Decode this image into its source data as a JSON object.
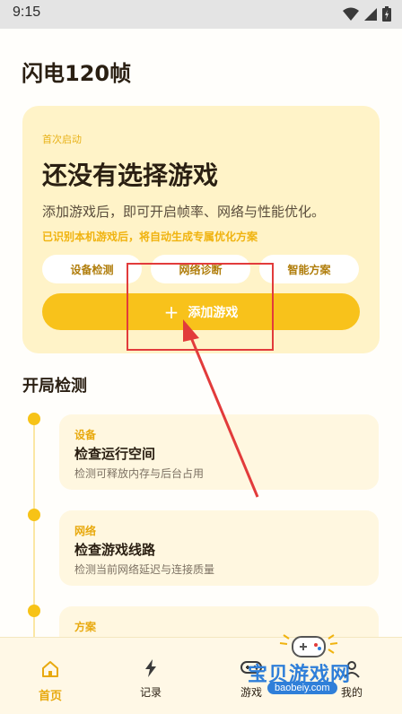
{
  "status_bar": {
    "time": "9:15",
    "icons": [
      "wifi-icon",
      "signal-icon",
      "battery-icon"
    ]
  },
  "page_title": "闪电120帧",
  "card": {
    "eyebrow": "首次启动",
    "heading": "还没有选择游戏",
    "description": "添加游戏后，即可开启帧率、网络与性能优化。",
    "hint": "已识别本机游戏后，将自动生成专属优化方案",
    "chips": [
      "设备检测",
      "网络诊断",
      "智能方案"
    ],
    "add_button": {
      "icon": "+",
      "label": "添加游戏"
    }
  },
  "section": {
    "title": "开局检测",
    "steps": [
      {
        "tag": "设备",
        "name": "检查运行空间",
        "sub": "检测可释放内存与后台占用"
      },
      {
        "tag": "网络",
        "name": "检查游戏线路",
        "sub": "检测当前网络延迟与连接质量"
      },
      {
        "tag": "方案",
        "name": "",
        "sub": ""
      }
    ]
  },
  "tabbar": {
    "tabs": [
      {
        "label": "首页",
        "icon": "home-icon",
        "active": true
      },
      {
        "label": "记录",
        "icon": "lightning-icon",
        "active": false
      },
      {
        "label": "游戏",
        "icon": "gamepad-icon",
        "active": false
      },
      {
        "label": "我的",
        "icon": "user-icon",
        "active": false
      }
    ]
  },
  "watermark": {
    "text": "宝贝游戏网",
    "url": "baobeiy.com"
  },
  "colors": {
    "accent": "#f8c21b",
    "card_bg": "#fff3c8",
    "annotation": "#e23b3b"
  }
}
